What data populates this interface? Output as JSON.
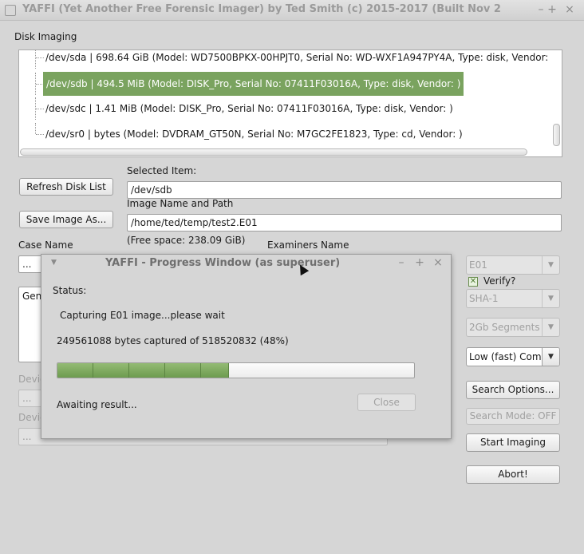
{
  "window": {
    "title": "YAFFI (Yet Another Free Forensic Imager) by Ted Smith (c) 2015-2017 (Built Nov 2",
    "minimize": "–",
    "maximize": "+",
    "close": "×"
  },
  "disk_imaging": {
    "label": "Disk Imaging",
    "disks": [
      "/dev/sda | 698.64 GiB (Model: WD7500BPKX-00HPJT0, Serial No: WD-WXF1A947PY4A, Type: disk, Vendor:",
      "/dev/sdb | 494.5 MiB (Model: DISK_Pro, Serial No: 07411F03016A, Type: disk, Vendor: )",
      "/dev/sdc | 1.41 MiB (Model: DISK_Pro, Serial No: 07411F03016A, Type: disk, Vendor: )",
      "/dev/sr0 |  bytes (Model: DVDRAM_GT50N, Serial No: M7GC2FE1823, Type: cd, Vendor: )"
    ],
    "selected_index": 1
  },
  "form": {
    "refresh_button": "Refresh Disk List",
    "selected_item_label": "Selected Item:",
    "selected_item_value": "/dev/sdb",
    "save_image_button": "Save Image As...",
    "image_name_label": "Image Name and Path",
    "image_name_value": "/home/ted/temp/test2.E01",
    "free_space": "(Free space: 238.09 GiB)",
    "case_name_label": "Case Name",
    "case_name_value": "...",
    "examiners_name_label": "Examiners Name",
    "general_partial": "Gene",
    "device_label_1": "Devic",
    "device_value_1": "...",
    "device_label_2": "Devic",
    "device_value_2": "..."
  },
  "options": {
    "format": "E01",
    "verify_label": "Verify?",
    "verify_checked": true,
    "hash": "SHA-1",
    "segments": "2Gb Segments",
    "compression": "Low (fast) Com",
    "search_options_button": "Search Options...",
    "search_mode_button": "Search Mode: OFF",
    "start_imaging_button": "Start Imaging",
    "abort_button": "Abort!"
  },
  "progress_window": {
    "title": "YAFFI - Progress Window (as superuser)",
    "minimize": "–",
    "maximize": "+",
    "close": "×",
    "status_label": "Status:",
    "status_text": "Capturing E01 image...please wait",
    "bytes_text": "249561088  bytes captured of 518520832 (48%)",
    "progress_fraction": 0.48,
    "result_text": "Awaiting result...",
    "close_button": "Close"
  }
}
